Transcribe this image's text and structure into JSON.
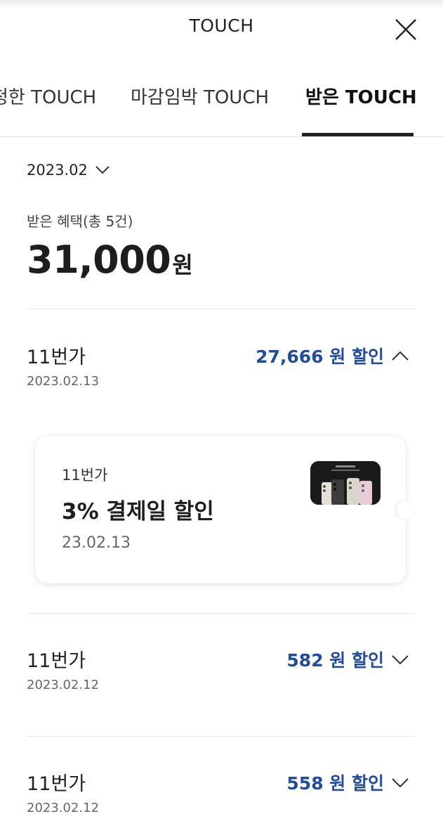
{
  "header": {
    "title": "TOUCH"
  },
  "tabs": [
    {
      "label": "청한 TOUCH"
    },
    {
      "label": "마감임박 TOUCH"
    },
    {
      "label": "받은 TOUCH",
      "active": true
    }
  ],
  "summary": {
    "month": "2023.02",
    "benefit_label": "받은 혜택(총 5건)",
    "total_amount": "31,000",
    "total_unit": "원"
  },
  "entries": [
    {
      "store": "11번가",
      "date": "2023.02.13",
      "amount": "27,666 원 할인",
      "expanded": true
    },
    {
      "store": "11번가",
      "date": "2023.02.12",
      "amount": "582 원 할인",
      "expanded": false
    },
    {
      "store": "11번가",
      "date": "2023.02.12",
      "amount": "558 원 할인",
      "expanded": false
    }
  ],
  "coupon": {
    "store": "11번가",
    "title": "3% 결제일 할인",
    "date": "23.02.13",
    "image": "galaxy-s23-phones-thumbnail"
  },
  "colors": {
    "accent_blue": "#234c9a",
    "text_primary": "#222222",
    "divider": "#e6e6e6"
  }
}
